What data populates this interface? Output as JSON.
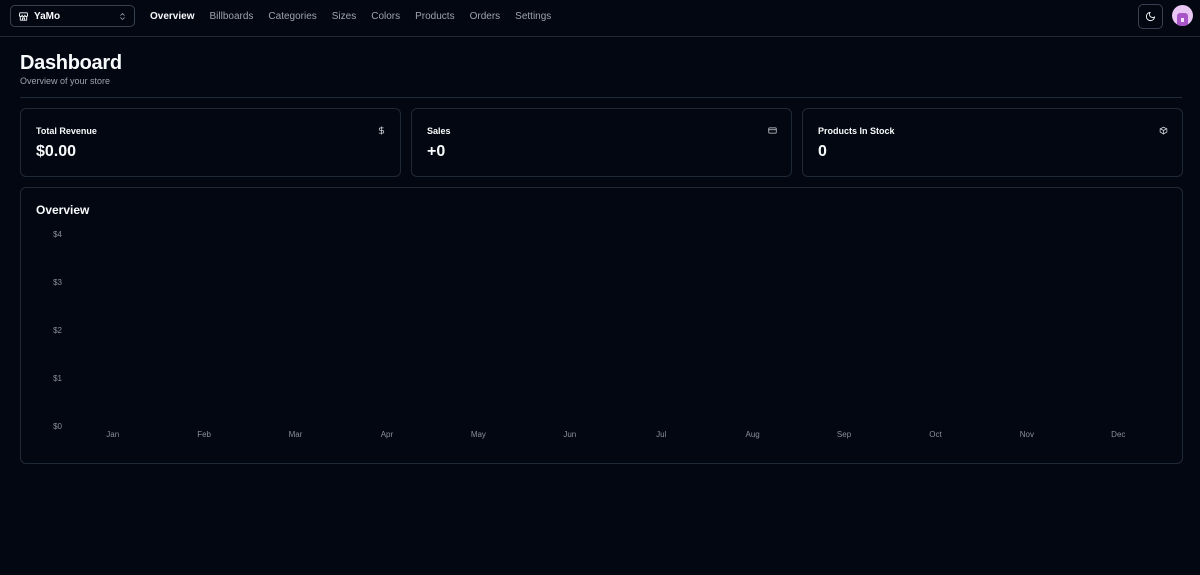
{
  "header": {
    "store_name": "YaMo",
    "nav": [
      {
        "label": "Overview",
        "active": true
      },
      {
        "label": "Billboards",
        "active": false
      },
      {
        "label": "Categories",
        "active": false
      },
      {
        "label": "Sizes",
        "active": false
      },
      {
        "label": "Colors",
        "active": false
      },
      {
        "label": "Products",
        "active": false
      },
      {
        "label": "Orders",
        "active": false
      },
      {
        "label": "Settings",
        "active": false
      }
    ],
    "theme_icon": "moon-icon",
    "avatar_icon": "user-avatar"
  },
  "page": {
    "title": "Dashboard",
    "subtitle": "Overview of your store"
  },
  "cards": [
    {
      "title": "Total Revenue",
      "value": "$0.00",
      "icon": "dollar-icon"
    },
    {
      "title": "Sales",
      "value": "+0",
      "icon": "credit-card-icon"
    },
    {
      "title": "Products In Stock",
      "value": "0",
      "icon": "package-icon"
    }
  ],
  "overview": {
    "title": "Overview"
  },
  "colors": {
    "background": "#030712",
    "border": "#1f2937",
    "text": "#f9fafb",
    "muted": "#9ca3af"
  },
  "chart_data": {
    "type": "bar",
    "categories": [
      "Jan",
      "Feb",
      "Mar",
      "Apr",
      "May",
      "Jun",
      "Jul",
      "Aug",
      "Sep",
      "Oct",
      "Nov",
      "Dec"
    ],
    "values": [
      0,
      0,
      0,
      0,
      0,
      0,
      0,
      0,
      0,
      0,
      0,
      0
    ],
    "y_ticks": [
      "$0",
      "$1",
      "$2",
      "$3",
      "$4"
    ],
    "ylim": [
      0,
      4
    ],
    "grid": false
  }
}
